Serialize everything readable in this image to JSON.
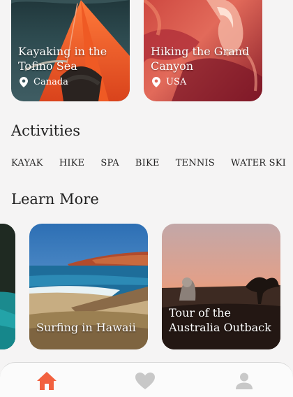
{
  "featured": [
    {
      "title": "Kayaking in the Tofino Sea",
      "location": "Canada"
    },
    {
      "title": "Hiking the Grand Canyon",
      "location": "USA"
    }
  ],
  "activities": {
    "title": "Activities",
    "items": [
      "KAYAK",
      "HIKE",
      "SPA",
      "BIKE",
      "TENNIS",
      "WATER SKI"
    ]
  },
  "learn_more": {
    "title": "Learn More",
    "cards": [
      {
        "title": ""
      },
      {
        "title": "Surfing in Hawaii"
      },
      {
        "title": "Tour of the Australia Outback"
      }
    ]
  },
  "tabbar": {
    "items": [
      "home-icon",
      "heart-icon",
      "profile-icon"
    ],
    "active_color": "#f2613f",
    "inactive_color": "#c8c8c8"
  }
}
